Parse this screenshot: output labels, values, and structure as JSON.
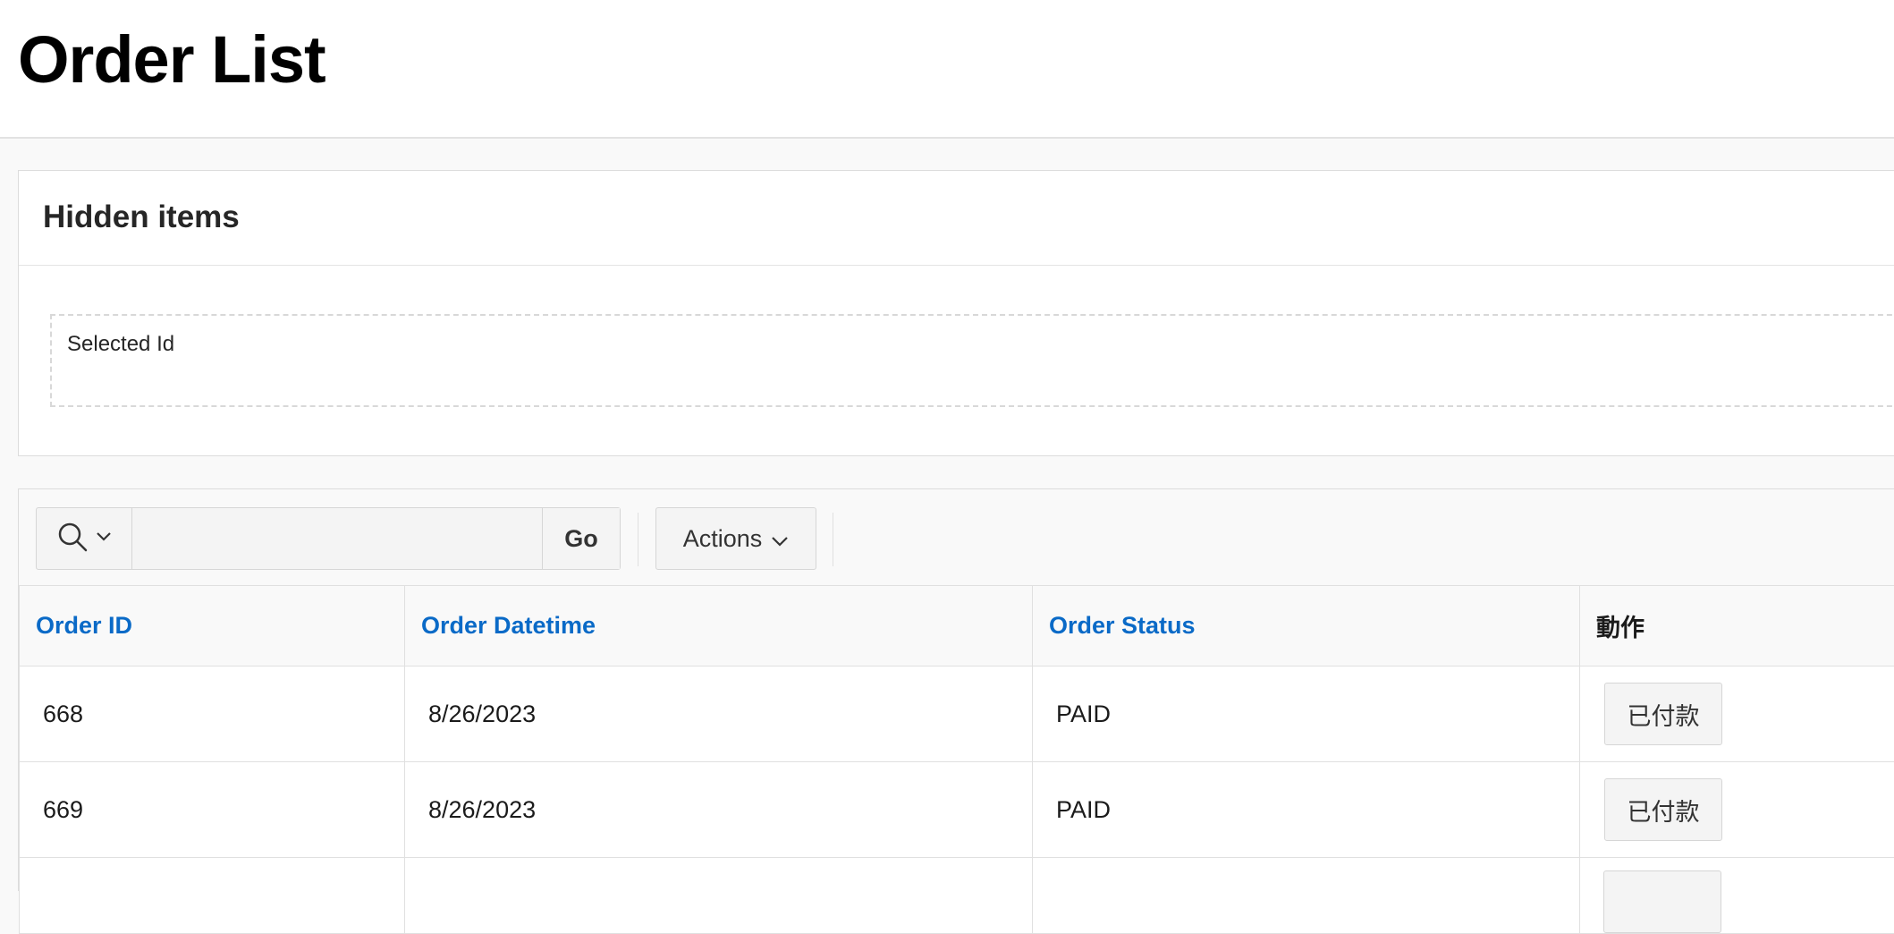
{
  "page": {
    "title": "Order List"
  },
  "hidden_region": {
    "title": "Hidden items",
    "fields": [
      {
        "label": "Selected Id",
        "value": ""
      }
    ]
  },
  "report": {
    "toolbar": {
      "search_placeholder": "",
      "go_label": "Go",
      "actions_label": "Actions"
    },
    "columns": [
      {
        "label": "Order ID",
        "sortable": true
      },
      {
        "label": "Order Datetime",
        "sortable": true
      },
      {
        "label": "Order Status",
        "sortable": true
      },
      {
        "label": "動作",
        "sortable": false
      }
    ],
    "rows": [
      {
        "order_id": "668",
        "order_datetime": "8/26/2023",
        "order_status": "PAID",
        "action_label": "已付款"
      },
      {
        "order_id": "669",
        "order_datetime": "8/26/2023",
        "order_status": "PAID",
        "action_label": "已付款"
      }
    ]
  },
  "colors": {
    "link": "#0a6ac7",
    "border": "#dcdcdc",
    "background": "#f9f9f9"
  }
}
